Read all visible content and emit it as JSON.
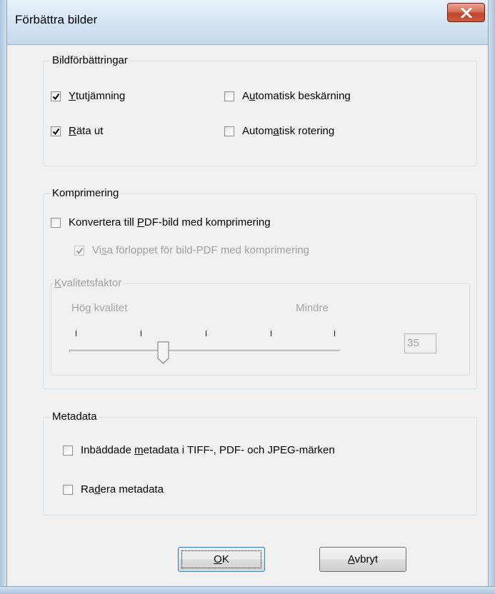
{
  "window": {
    "title": "Förbättra bilder",
    "close_icon": "close-x-icon"
  },
  "enhancements": {
    "legend": "Bildförbättringar",
    "items": [
      {
        "pre": "",
        "key": "Y",
        "post": "tutjämning",
        "checked": true
      },
      {
        "pre": "A",
        "key": "u",
        "post": "tomatisk beskärning",
        "checked": false
      },
      {
        "pre": "",
        "key": "R",
        "post": "äta ut",
        "checked": true
      },
      {
        "pre": "Autom",
        "key": "a",
        "post": "tisk rotering",
        "checked": false
      }
    ]
  },
  "compression": {
    "legend": "Komprimering",
    "convert": {
      "pre": "Konvertera till ",
      "key": "P",
      "post": "DF-bild med komprimering",
      "checked": false
    },
    "show_progress": {
      "pre": "Vi",
      "key": "s",
      "post": "a förloppet för bild-PDF med komprimering",
      "checked": true,
      "disabled": true
    },
    "quality": {
      "legend_key": "K",
      "legend_rest": "valitetsfaktor",
      "high_label": "Hög kvalitet",
      "low_label": "Mindre",
      "value": "35",
      "slider_fraction": 0.33
    }
  },
  "metadata": {
    "legend": "Metadata",
    "embedded": {
      "pre": "Inbäddade ",
      "key": "m",
      "post": "etadata i TIFF-, PDF- och JPEG-märken",
      "checked": false
    },
    "delete": {
      "pre": "Ra",
      "key": "d",
      "post": "era metadata",
      "checked": false
    }
  },
  "buttons": {
    "ok": {
      "key": "O",
      "post": "K"
    },
    "cancel": {
      "key": "A",
      "post": "vbryt"
    }
  }
}
